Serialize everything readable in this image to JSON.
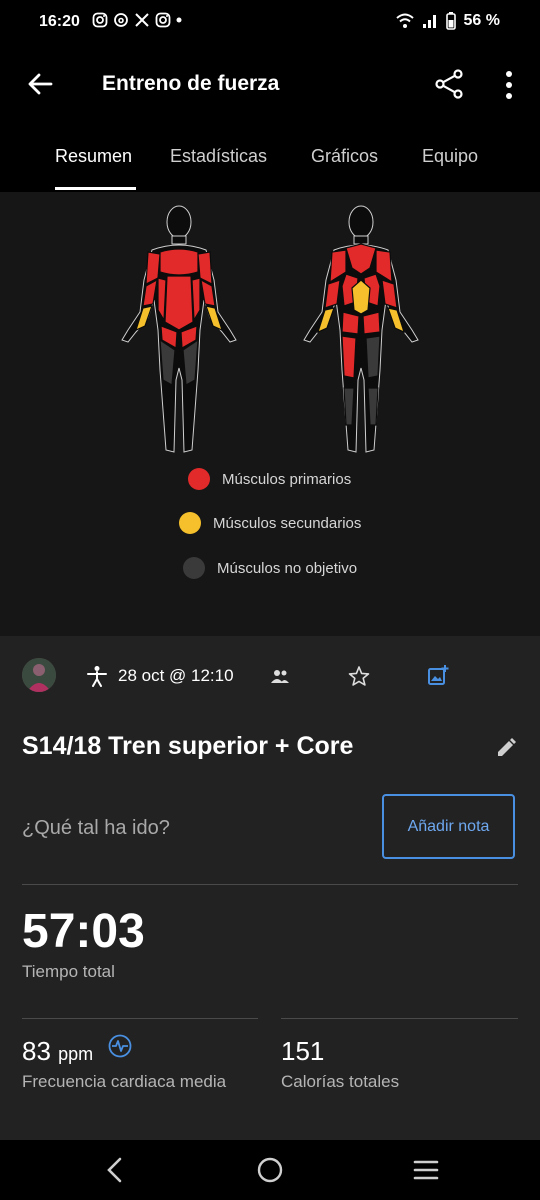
{
  "status_bar": {
    "time": "16:20",
    "battery": "56 %"
  },
  "header": {
    "title": "Entreno de fuerza"
  },
  "tabs": [
    {
      "label": "Resumen",
      "active": true
    },
    {
      "label": "Estadísticas",
      "active": false
    },
    {
      "label": "Gráficos",
      "active": false
    },
    {
      "label": "Equipo",
      "active": false
    }
  ],
  "legend": [
    {
      "label": "Músculos primarios",
      "color": "#e32a2a"
    },
    {
      "label": "Músculos secundarios",
      "color": "#f5c02b"
    },
    {
      "label": "Músculos no objetivo",
      "color": "#3a3a3a"
    }
  ],
  "activity": {
    "date": "28 oct @ 12:10",
    "name": "S14/18 Tren superior + Core",
    "question": "¿Qué tal ha ido?",
    "add_note": "Añadir nota",
    "total_time": "57:03",
    "total_time_label": "Tiempo total",
    "heart_rate": "83",
    "heart_rate_unit": "ppm",
    "heart_rate_label": "Frecuencia cardiaca media",
    "calories": "151",
    "calories_label": "Calorías totales"
  },
  "colors": {
    "primary": "#e32a2a",
    "secondary": "#f5c02b",
    "inactive": "#3a3a3a",
    "accent": "#4a90e2"
  }
}
